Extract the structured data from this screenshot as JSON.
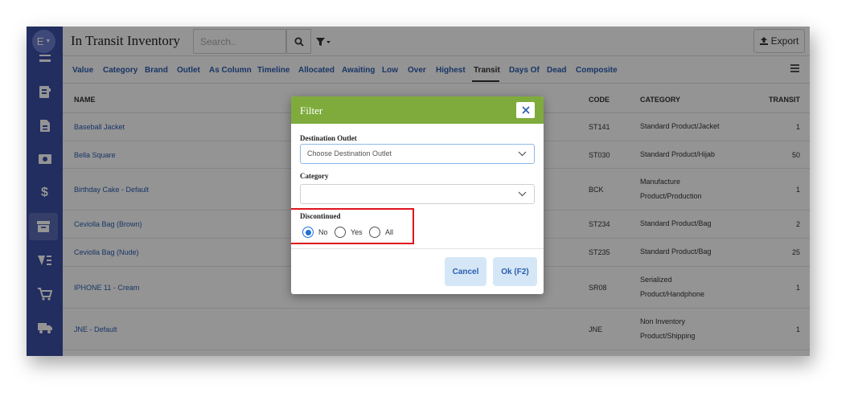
{
  "sidebar": {
    "avatar_letter": "E",
    "items": [
      {
        "icon": "list-icon",
        "glyph": "▬"
      },
      {
        "icon": "document-icon",
        "glyph": "▤"
      },
      {
        "icon": "file-icon",
        "glyph": "▣"
      },
      {
        "icon": "camera-icon",
        "glyph": "◙"
      },
      {
        "icon": "dollar-icon",
        "glyph": "$"
      },
      {
        "icon": "archive-icon",
        "glyph": "▭"
      },
      {
        "icon": "tags-icon",
        "glyph": "▾"
      },
      {
        "icon": "cart-icon",
        "glyph": "⛟"
      },
      {
        "icon": "truck-icon",
        "glyph": "⛟"
      }
    ]
  },
  "header": {
    "title": "In Transit Inventory",
    "search_placeholder": "Search..",
    "export_label": "Export"
  },
  "tabs": [
    "Value",
    "Category",
    "Brand",
    "Outlet",
    "As Column",
    "Timeline",
    "Allocated",
    "Awaiting",
    "Low",
    "Over",
    "Highest",
    "Transit",
    "Days Of",
    "Dead",
    "Composite"
  ],
  "active_tab": "Transit",
  "table": {
    "headers": {
      "name": "NAME",
      "code": "CODE",
      "category": "CATEGORY",
      "transit": "TRANSIT"
    },
    "rows": [
      {
        "name": "Baseball Jacket",
        "code": "ST141",
        "category_1": "Standard Product/Jacket",
        "category_2": "",
        "transit": "1"
      },
      {
        "name": "Bella Square",
        "code": "ST030",
        "category_1": "Standard Product/Hijab",
        "category_2": "",
        "transit": "50"
      },
      {
        "name": "Birthday Cake - Default",
        "code": "BCK",
        "category_1": "Manufacture",
        "category_2": "Product/Production",
        "transit": "1"
      },
      {
        "name": "Ceviolla Bag (Brown)",
        "code": "ST234",
        "category_1": "Standard Product/Bag",
        "category_2": "",
        "transit": "2"
      },
      {
        "name": "Ceviolla Bag (Nude)",
        "code": "ST235",
        "category_1": "Standard Product/Bag",
        "category_2": "",
        "transit": "25"
      },
      {
        "name": "IPHONE 11 - Cream",
        "code": "SR08",
        "category_1": "Serialized",
        "category_2": "Product/Handphone",
        "transit": "1"
      },
      {
        "name": "JNE - Default",
        "code": "JNE",
        "category_1": "Non Inventory",
        "category_2": "Product/Shipping",
        "transit": "1"
      }
    ]
  },
  "modal": {
    "title": "Filter",
    "destination_label": "Destination Outlet",
    "destination_placeholder": "Choose Destination Outlet",
    "category_label": "Category",
    "category_value": "",
    "discontinued_label": "Discontinued",
    "options": [
      "No",
      "Yes",
      "All"
    ],
    "selected_option": "No",
    "cancel_label": "Cancel",
    "ok_label": "Ok (F2)",
    "header_color": "#7fab3c",
    "highlight_color": "#e0141b"
  }
}
